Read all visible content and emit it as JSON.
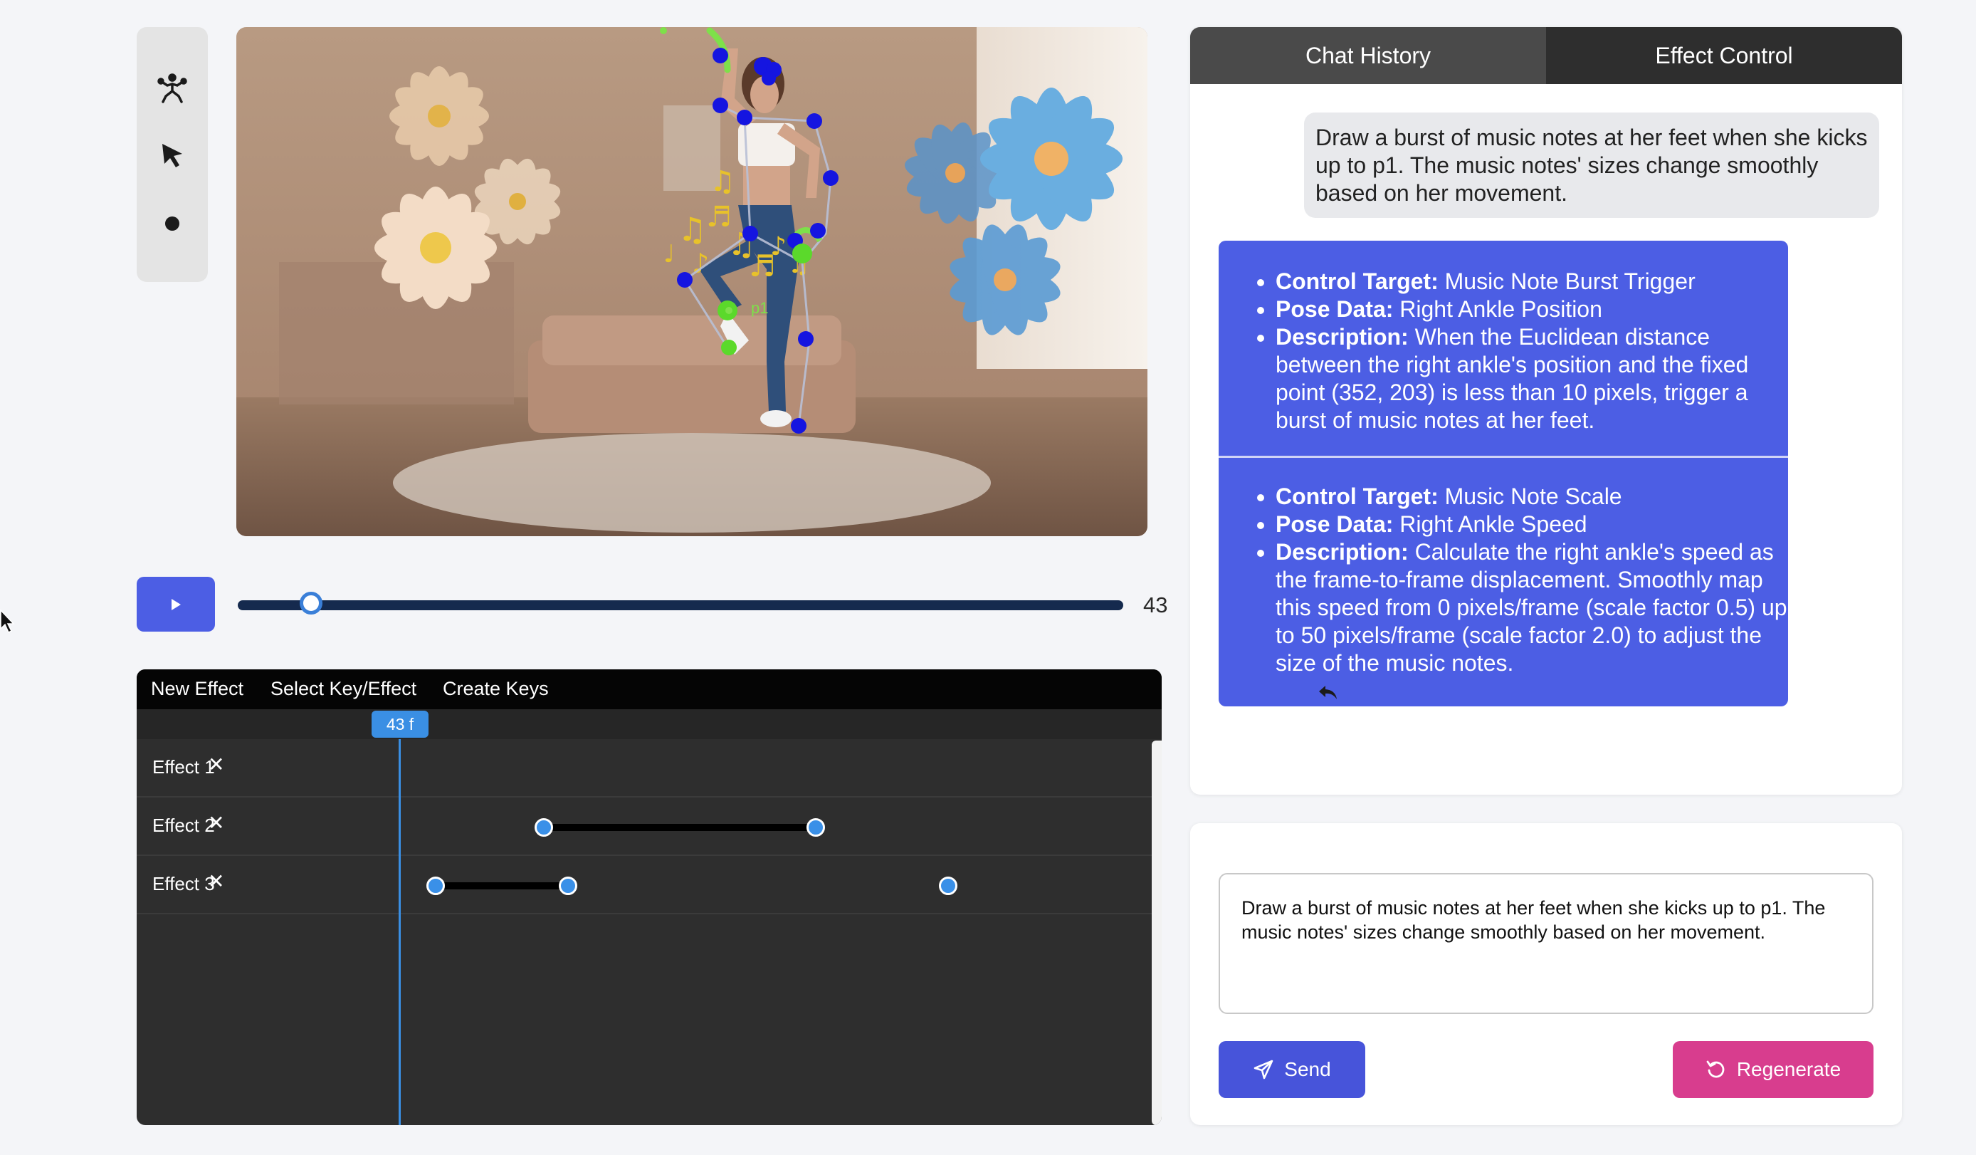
{
  "toolbar": {
    "tools": [
      {
        "icon": "pose-skeleton-icon"
      },
      {
        "icon": "pointer-arrow-icon"
      },
      {
        "icon": "dot-point-icon"
      }
    ]
  },
  "video": {
    "point_label": "p1"
  },
  "playback": {
    "frame": "43",
    "progress": 0.083
  },
  "timeline": {
    "menu": [
      "New Effect",
      "Select Key/Effect",
      "Create Keys"
    ],
    "current_frame_label": "43 f",
    "rows": [
      {
        "label": "Effect 1",
        "delete_glyph": "✕"
      },
      {
        "label": "Effect 2",
        "delete_glyph": "✕"
      },
      {
        "label": "Effect 3",
        "delete_glyph": "✕"
      }
    ]
  },
  "tabs": {
    "chat": "Chat History",
    "effect": "Effect Control"
  },
  "chat": {
    "user_message": "Draw a burst of music notes at her feet when she kicks up to p1. The music notes' sizes change smoothly based on her movement.",
    "ai_sections": [
      {
        "items": [
          {
            "key": "Control Target:",
            "value": " Music Note Burst Trigger"
          },
          {
            "key": "Pose Data:",
            "value": " Right Ankle Position"
          },
          {
            "key": "Description:",
            "value": " When the Euclidean distance between the right ankle's position and the fixed point (352, 203) is less than 10 pixels, trigger a burst of music notes at her feet."
          }
        ]
      },
      {
        "items": [
          {
            "key": "Control Target:",
            "value": " Music Note Scale"
          },
          {
            "key": "Pose Data:",
            "value": " Right Ankle Speed"
          },
          {
            "key": "Description:",
            "value": " Calculate the right ankle's speed as the frame-to-frame displacement. Smoothly map this speed from 0 pixels/frame (scale factor 0.5) up to 50 pixels/frame (scale factor 2.0) to adjust the size of the music notes."
          }
        ]
      }
    ]
  },
  "input": {
    "value": "Draw a burst of music notes at her feet when she kicks up to p1. The music notes' sizes change smoothly based on her movement.",
    "send_label": "Send",
    "regenerate_label": "Regenerate"
  },
  "colors": {
    "accent": "#4c5ee4",
    "regenerate": "#d83d8e",
    "keyframe": "#3a90e8",
    "timeline_bg": "#2e2e2e"
  }
}
